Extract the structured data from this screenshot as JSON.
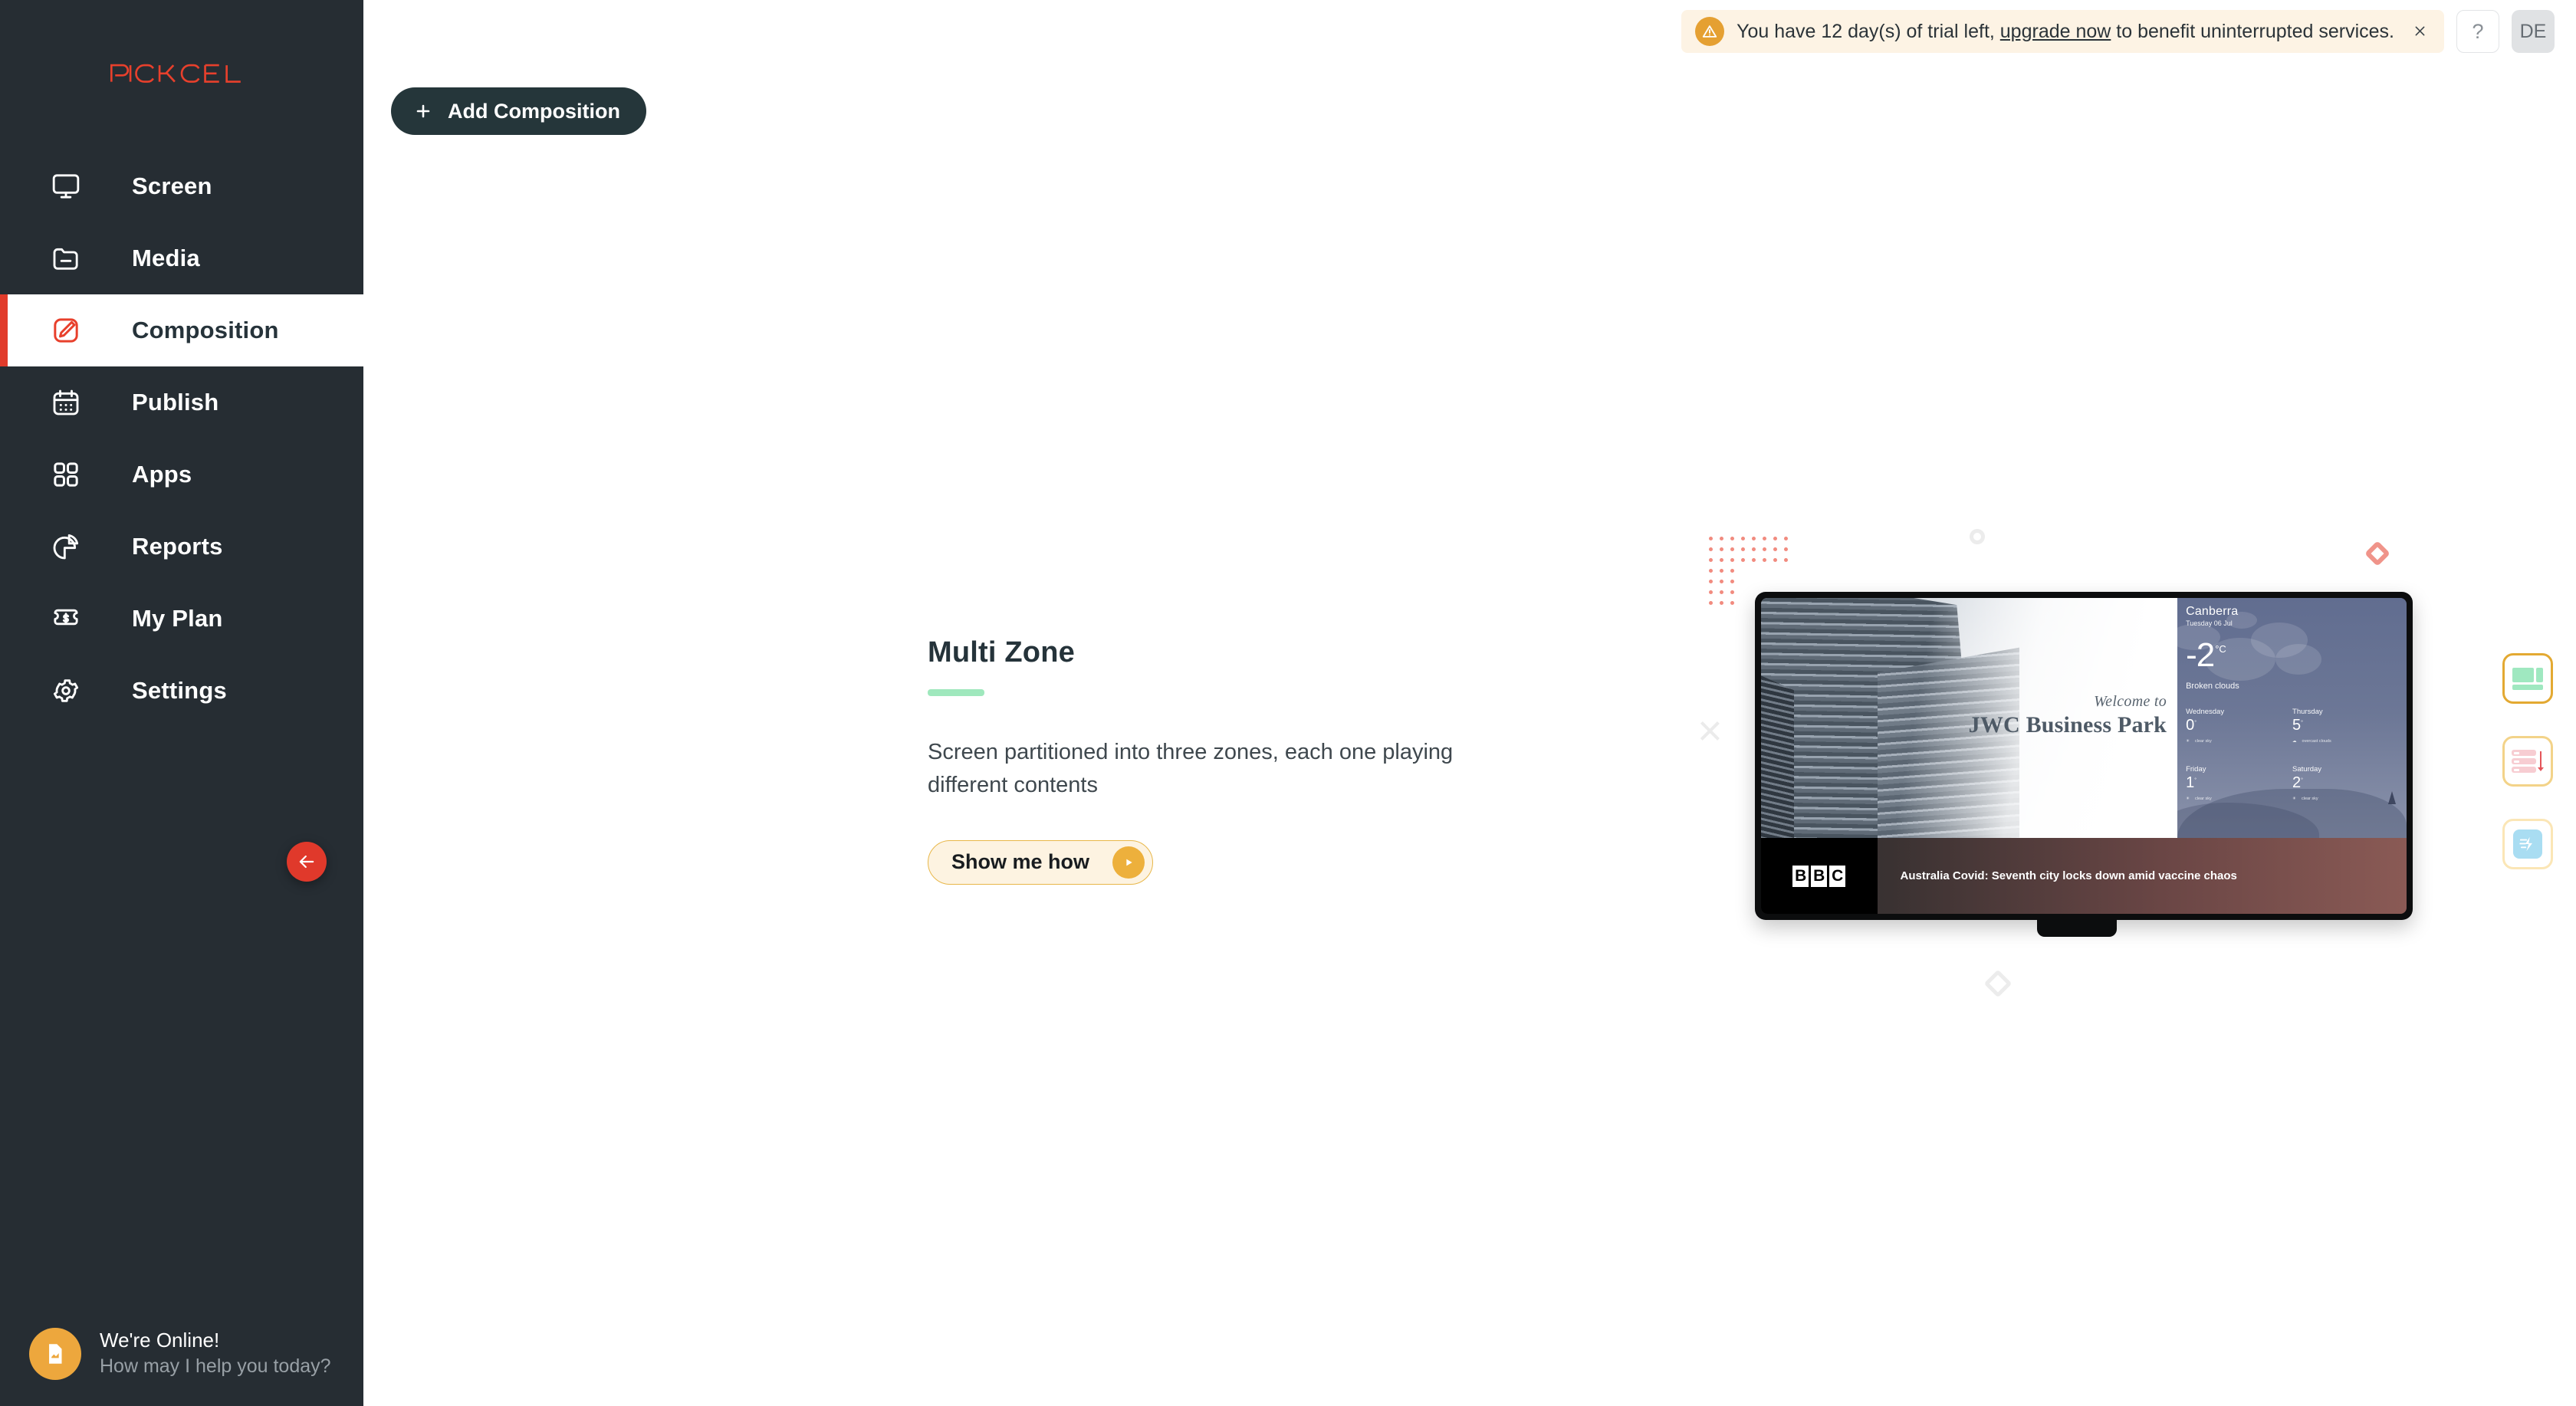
{
  "brand": {
    "logo_text": "PICKCEL",
    "logo_color": "#e8402c",
    "accent_red": "#e0392b",
    "sidebar_bg": "#262d33"
  },
  "sidebar": {
    "items": [
      {
        "label": "Screen",
        "icon": "monitor-icon",
        "active": false
      },
      {
        "label": "Media",
        "icon": "folder-icon",
        "active": false
      },
      {
        "label": "Composition",
        "icon": "edit-pencil-icon",
        "active": true
      },
      {
        "label": "Publish",
        "icon": "calendar-icon",
        "active": false
      },
      {
        "label": "Apps",
        "icon": "grid-apps-icon",
        "active": false
      },
      {
        "label": "Reports",
        "icon": "pie-chart-icon",
        "active": false
      },
      {
        "label": "My Plan",
        "icon": "ticket-dollar-icon",
        "active": false
      },
      {
        "label": "Settings",
        "icon": "gear-icon",
        "active": false
      }
    ],
    "collapse_icon": "arrow-left-icon"
  },
  "chat_widget": {
    "icon": "chat-document-icon",
    "title": "We're Online!",
    "subtitle": "How may I help you today?"
  },
  "topbar": {
    "banner": {
      "icon": "warning-triangle-icon",
      "text_before": "You have 12 day(s) of trial left, ",
      "link_text": "upgrade now",
      "text_after": " to benefit uninterrupted services.",
      "close_icon": "close-icon",
      "bg_color": "#fdf3e4",
      "icon_color": "#e5a032"
    },
    "help_label": "?",
    "avatar_initials": "DE"
  },
  "toolbar": {
    "add_composition_label": "Add Composition",
    "add_icon": "plus-icon"
  },
  "hero": {
    "title": "Multi Zone",
    "description": "Screen partitioned into three zones, each one playing different contents",
    "cta_label": "Show me how",
    "cta_icon": "play-icon",
    "rule_color": "#9fe8bd"
  },
  "preview": {
    "zone_main": {
      "welcome_line": "Welcome to",
      "venue_name": "JWC Business Park"
    },
    "zone_weather": {
      "city": "Canberra",
      "date": "Tuesday 06 Jul",
      "temperature": "-2",
      "unit": "°C",
      "condition": "Broken clouds",
      "forecast": [
        {
          "day": "Wednesday",
          "temp": "0",
          "unit": "°",
          "desc": "clear sky",
          "icon": "sun-icon"
        },
        {
          "day": "Thursday",
          "temp": "5",
          "unit": "°",
          "desc": "overcast clouds",
          "icon": "cloud-icon"
        },
        {
          "day": "Friday",
          "temp": "1",
          "unit": "°",
          "desc": "clear sky",
          "icon": "sun-icon"
        },
        {
          "day": "Saturday",
          "temp": "2",
          "unit": "°",
          "desc": "clear sky",
          "icon": "sun-icon"
        }
      ]
    },
    "zone_ticker": {
      "source": "BBC",
      "source_letters": [
        "B",
        "B",
        "C"
      ],
      "headline": "Australia Covid: Seventh city locks down amid vaccine chaos"
    }
  },
  "feature_buttons": [
    {
      "name": "multi-zone-layout",
      "icon": "multizone-icon",
      "border_color": "#e3a932",
      "glyph_color": "#9fe8c0"
    },
    {
      "name": "playlist",
      "icon": "playlist-icon",
      "border_color": "#f3d389",
      "glyph_color": "#f7cdd2"
    },
    {
      "name": "quick-publish",
      "icon": "quick-publish-icon",
      "border_color": "#fbe6b6",
      "glyph_color": "#a9ddf2"
    }
  ],
  "decor": {
    "dot_grid_red_color": "#f18b7f",
    "dot_grid_orange_color": "#f2b32e",
    "shape_gray": "#ececec",
    "diamond_red": "#f0948a"
  }
}
